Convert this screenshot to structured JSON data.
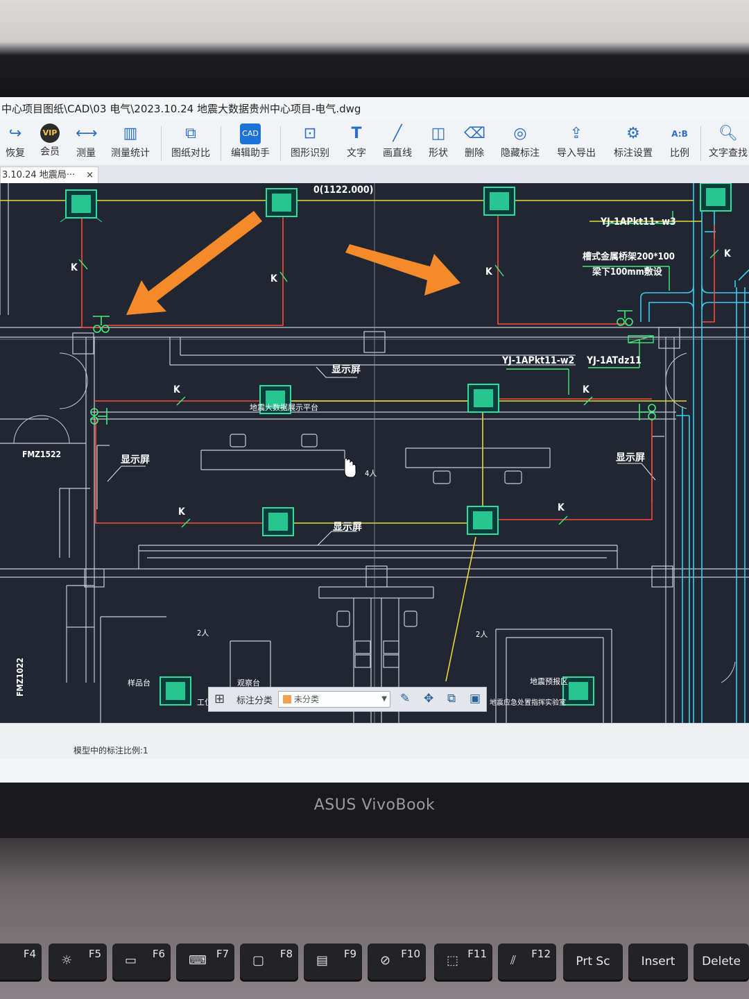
{
  "window": {
    "title": "中心项目图纸\\CAD\\03 电气\\2023.10.24 地震大数据贵州中心项目-电气.dwg"
  },
  "toolbar": {
    "items": [
      {
        "label": "恢复",
        "icon": "redo-icon"
      },
      {
        "label": "会员",
        "icon": "vip-icon"
      },
      {
        "label": "测量",
        "icon": "measure-icon"
      },
      {
        "label": "测量统计",
        "icon": "measure-stats-icon"
      },
      {
        "label": "图纸对比",
        "icon": "compare-icon"
      },
      {
        "label": "编辑助手",
        "icon": "cad-edit-icon"
      },
      {
        "label": "图形识别",
        "icon": "shape-recognize-icon"
      },
      {
        "label": "文字",
        "icon": "text-icon"
      },
      {
        "label": "画直线",
        "icon": "line-icon"
      },
      {
        "label": "形状",
        "icon": "shape-icon"
      },
      {
        "label": "删除",
        "icon": "eraser-icon"
      },
      {
        "label": "隐藏标注",
        "icon": "hide-icon"
      },
      {
        "label": "导入导出",
        "icon": "import-export-icon"
      },
      {
        "label": "标注设置",
        "icon": "annotation-settings-icon"
      },
      {
        "label": "比例",
        "icon": "scale-icon"
      },
      {
        "label": "文字查找",
        "icon": "text-search-icon"
      }
    ],
    "vip_badge": "VIP",
    "scale_badge": "A:B"
  },
  "document_tab": {
    "label": "3.10.24 地震局···",
    "close": "×"
  },
  "drawing": {
    "labels": {
      "coord": "0(1122.000)",
      "cable1": "YJ-1APkt11- w3",
      "tray_line1": "槽式金属桥架200*100",
      "tray_line2": "梁下100mm敷设",
      "cable2": "YJ-1APkt11-w2",
      "cable3": "YJ-1ATdz11",
      "display1": "显示屏",
      "display2": "显示屏",
      "display3": "显示屏",
      "display4": "显示屏",
      "k1": "K",
      "k2": "K",
      "k3": "K",
      "k4": "K",
      "k5": "K",
      "k6": "K",
      "k7": "K",
      "k8": "K",
      "door1": "FMZ1522",
      "door2": "FMZ1022",
      "platform": "地震大数据展示平台",
      "persons1": "4人",
      "persons2": "2人",
      "persons3": "2人",
      "room1": "样品台",
      "room2": "观察台",
      "room3": "地震预报区",
      "room4": "地震应急处置指挥实验室",
      "work": "工位"
    }
  },
  "annotation_bar": {
    "label": "标注分类",
    "selected": "未分类",
    "swatch_color": "#f2a154"
  },
  "status": {
    "scale_text": "模型中的标注比例:1"
  },
  "laptop": {
    "brand": "ASUS VivoBook"
  },
  "keys": [
    {
      "fn": "F4"
    },
    {
      "fn": "F5",
      "icon": "brightness-icon"
    },
    {
      "fn": "F6",
      "icon": "display-icon"
    },
    {
      "fn": "F7",
      "icon": "keyboard-light-icon"
    },
    {
      "fn": "F8",
      "icon": "projector-icon"
    },
    {
      "fn": "F9",
      "icon": "touchpad-icon"
    },
    {
      "fn": "F10",
      "icon": "camera-off-icon"
    },
    {
      "fn": "F11",
      "icon": "screenshot-icon"
    },
    {
      "fn": "F12",
      "icon": "myasus-icon"
    },
    {
      "label": "Prt Sc"
    },
    {
      "label": "Insert"
    },
    {
      "label": "Delete"
    }
  ],
  "colors": {
    "canvas_bg": "#212633",
    "wire_red": "#ff4a3a",
    "wire_yellow": "#e8d83a",
    "tray_cyan": "#39d0f0",
    "device_green": "#2ee0a0",
    "arrow_orange": "#f58a2a"
  }
}
